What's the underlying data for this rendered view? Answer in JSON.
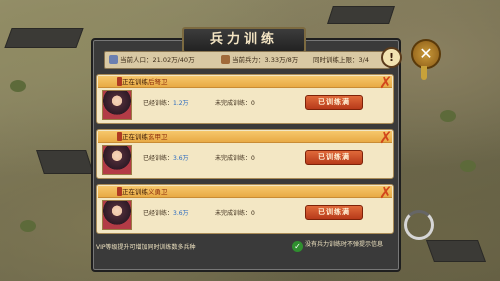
{
  "window": {
    "title": "兵力训练"
  },
  "status": {
    "population_label": "当前人口：",
    "population_value": "21.02万/40万",
    "troops_label": "当前兵力：",
    "troops_value": "3.33万/8万",
    "queue_label": "同时训练上限：",
    "queue_value": "3/4"
  },
  "cards": [
    {
      "status": "正在训练",
      "unit": "后弩卫",
      "trained_label": "已经训练：",
      "trained_value": "1.2万",
      "pending_label": "未完成训练：",
      "pending_value": "0",
      "button": "已训练满"
    },
    {
      "status": "正在训练",
      "unit": "玄甲卫",
      "trained_label": "已经训练：",
      "trained_value": "3.6万",
      "pending_label": "未完成训练：",
      "pending_value": "0",
      "button": "已训练满"
    },
    {
      "status": "正在训练",
      "unit": "义勇卫",
      "trained_label": "已经训练：",
      "trained_value": "3.6万",
      "pending_label": "未完成训练：",
      "pending_value": "0",
      "button": "已训练满"
    }
  ],
  "footer": {
    "vip_hint": "VIP等级提升可增加同时训练数多兵种",
    "checkbox_label": "没有兵力训练时不弹提示信息"
  },
  "colors": {
    "accent": "#e06a3a",
    "card_bg": "#f3e7c4",
    "header_bg": "#f6c76b",
    "value_blue": "#2a6ac0"
  },
  "icons": [
    "population-icon",
    "troops-icon",
    "info-icon",
    "close-icon",
    "remove-x-icon",
    "check-icon",
    "loading-icon"
  ]
}
